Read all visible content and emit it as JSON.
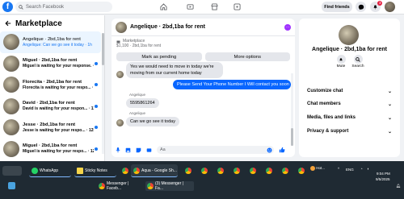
{
  "topbar": {
    "search_placeholder": "Search Facebook",
    "logo": "f",
    "find_friends": "Find friends",
    "notifications_badge": "3",
    "icons": [
      "home-icon",
      "video-icon",
      "marketplace-icon",
      "grid-menu-icon",
      "messenger-icon",
      "bell-icon",
      "profile-avatar"
    ]
  },
  "left": {
    "title": "Marketplace",
    "conversations": [
      {
        "title": "Angelique · 2bd,1ba for rent",
        "preview": "Angelique: Can we go see it today · 1h",
        "active": true,
        "unread": false
      },
      {
        "title": "Miguel · 2bd,1ba for rent",
        "preview": "Miguel is waiting for your response. · 1h",
        "active": false,
        "unread": true
      },
      {
        "title": "Florecita · 2bd,1ba for rent",
        "preview": "Florecita is waiting for your respo... · 11h",
        "active": false,
        "unread": true
      },
      {
        "title": "David · 2bd,1ba for rent",
        "preview": "David is waiting for your respon... · 11h",
        "active": false,
        "unread": true
      },
      {
        "title": "Jesse · 2bd,1ba for rent",
        "preview": "Jesse is waiting for your respo... · 12h",
        "active": false,
        "unread": true
      },
      {
        "title": "Miguel · 2bd,1ba for rent",
        "preview": "Miguel is waiting for your respo... · 12h",
        "active": false,
        "unread": true
      }
    ]
  },
  "chat": {
    "name": "Angelique · 2bd,1ba for rent",
    "listing_seller": "Marketplace",
    "listing_price": "$1,100 · 2bd,1ba for rent",
    "mark_pending": "Mark as pending",
    "more_options": "More options",
    "messages": {
      "m1": "Yes we would need to move in today we're moving from our current home today",
      "m2": "Please Send Your Phone Number I Will contact you soon",
      "sender": "Angelique",
      "m3": "5595861264",
      "m4": "Can we go see it today"
    },
    "composer_placeholder": "Aa"
  },
  "right": {
    "name": "Angelique · 2bd,1ba for rent",
    "mute": "Mute",
    "search": "Search",
    "items": [
      "Customize chat",
      "Chat members",
      "Media, files and links",
      "Privacy & support"
    ]
  },
  "taskbar": {
    "apps_row1": [
      "WhatsApp",
      "Sticky Notes",
      "",
      "Aqua - Google Sh...",
      "",
      "",
      "",
      "",
      "",
      "",
      ""
    ],
    "apps_row2": [
      "Messenger | Faceb...",
      "(3) Messenger | Fa..."
    ],
    "weather": "Hot...",
    "time": "9:04 PM",
    "date": "9/5/2025",
    "lang": "ENG"
  },
  "colors": {
    "accent": "#1877f2",
    "bubble_out": "#0866ff",
    "taskbar": "#1f2a33"
  }
}
